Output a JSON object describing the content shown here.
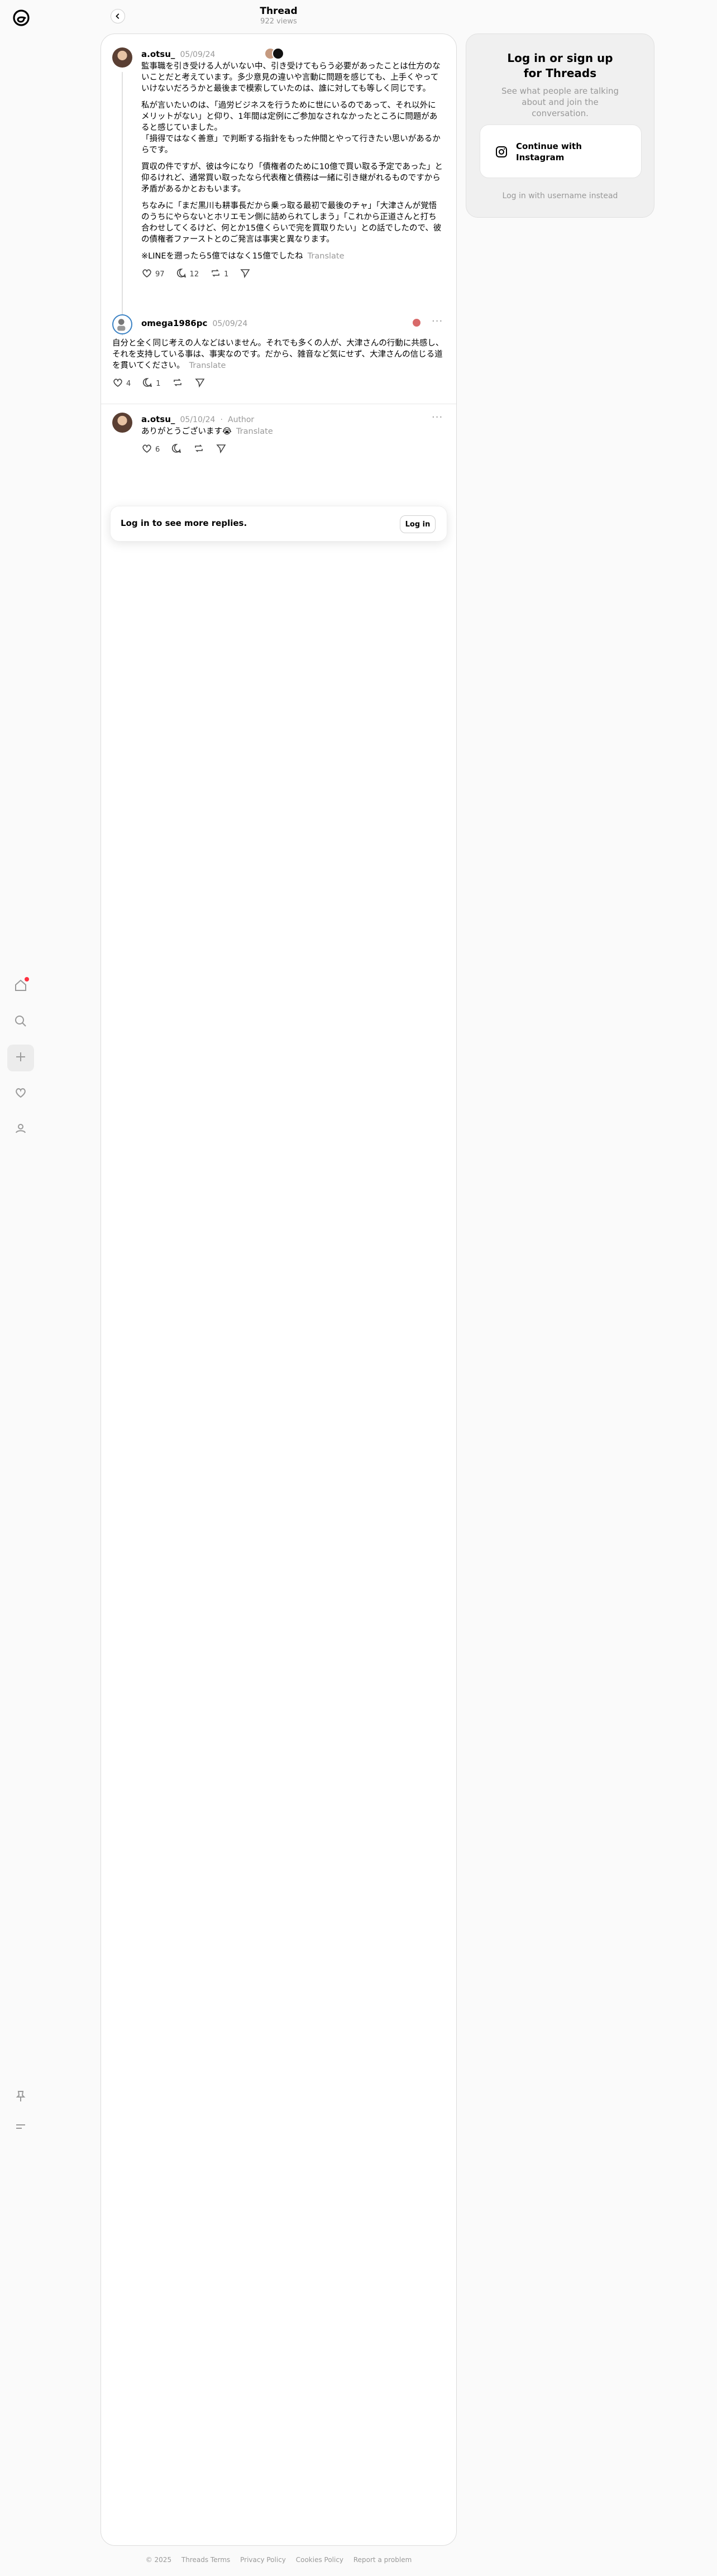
{
  "header": {
    "title": "Thread",
    "views": "922 views"
  },
  "nav": {
    "items": [
      "home-icon",
      "search-icon",
      "create-icon",
      "activity-icon",
      "profile-icon",
      "pin-icon",
      "menu-icon"
    ],
    "accent": "#ff3040"
  },
  "posts": [
    {
      "handle": "a.otsu_",
      "date": "05/09/24",
      "paragraphs": [
        "監事職を引き受ける人がいない中、引き受けてもらう必要があったことは仕方のないことだと考えています。多少意見の違いや言動に問題を感じても、上手くやっていけないだろうかと最後まで模索していたのは、誰に対しても等しく同じです。",
        "私が言いたいのは、「過労ビジネスを行うために世にいるのであって、それ以外にメリットがない」と仰り、1年間は定例にご参加なされなかったところに問題があると感じていました。\n「損得ではなく善意」で判断する指針をもった仲間とやって行きたい思いがあるからです。",
        "買収の件ですが、彼は今になり「債権者のために10億で買い取る予定であった」と仰るけれど、通常買い取ったなら代表権と債務は一緒に引き継がれるものですから矛盾があるかとおもいます。",
        "ちなみに「まだ黒川も耕事長だから乗っ取る最初で最後のチャ」「大津さんが覚悟のうちにやらないとホリエモン側に詰められてしまう」「これから正道さんと打ち合わせしてくるけど、何とか15億くらいで完を買取りたい」との話でしたので、彼の債権者ファーストとのご発言は事実と異なります。",
        "※LINEを遡ったら5億ではなく15億でしたね"
      ],
      "translate": "Translate",
      "likes": "97",
      "replies": "12",
      "reposts": "1",
      "shares": ""
    },
    {
      "handle": "omega1986pc",
      "date": "05/09/24",
      "text": "自分と全く同じ考えの人などはいません。それでも多くの人が、大津さんの行動に共感し、それを支持している事は、事実なのです。だから、雑音など気にせず、大津さんの信じる道を貫いてください。",
      "translate": "Translate",
      "likes": "4",
      "replies": "1",
      "reposts": "",
      "shares": ""
    },
    {
      "handle": "a.otsu_",
      "date": "05/10/24",
      "author_tag": "Author",
      "text": "ありがとうございます😭",
      "translate": "Translate",
      "likes": "6",
      "replies": "",
      "reposts": "",
      "shares": ""
    }
  ],
  "more_replies": {
    "text": "Log in to see more replies.",
    "button": "Log in"
  },
  "login_panel": {
    "title": "Log in or sign up for Threads",
    "subtitle": "See what people are talking about and join the conversation.",
    "instagram_button": "Continue with Instagram",
    "alt_login": "Log in with username instead"
  },
  "footer": [
    "© 2025",
    "Threads Terms",
    "Privacy Policy",
    "Cookies Policy",
    "Report a problem"
  ]
}
